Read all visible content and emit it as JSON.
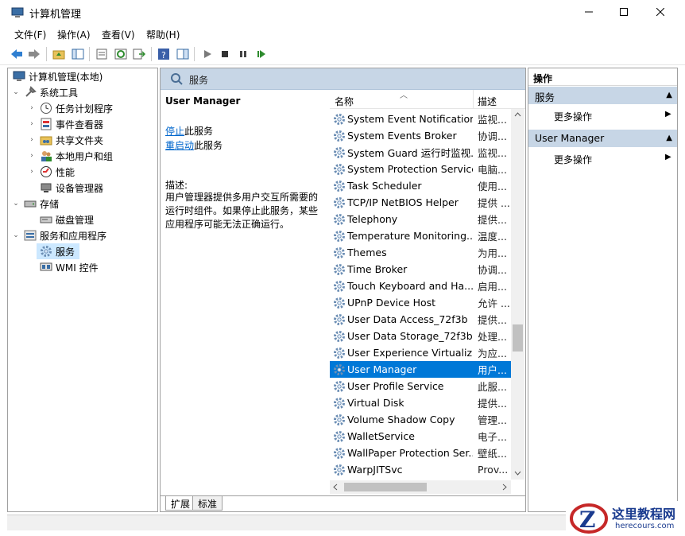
{
  "window": {
    "title": "计算机管理"
  },
  "menu": [
    "文件(F)",
    "操作(A)",
    "查看(V)",
    "帮助(H)"
  ],
  "tree": {
    "root": "计算机管理(本地)",
    "system_tools": "系统工具",
    "task_scheduler": "任务计划程序",
    "event_viewer": "事件查看器",
    "shared_folders": "共享文件夹",
    "local_users": "本地用户和组",
    "performance": "性能",
    "device_manager": "设备管理器",
    "storage": "存储",
    "disk_mgmt": "磁盘管理",
    "services_apps": "服务和应用程序",
    "services": "服务",
    "wmi": "WMI 控件"
  },
  "services_panel": {
    "header": "服务",
    "selected_name": "User Manager",
    "stop_link": "停止",
    "stop_suffix": "此服务",
    "restart_link": "重启动",
    "restart_suffix": "此服务",
    "desc_label": "描述:",
    "description": "用户管理器提供多用户交互所需要的运行时组件。如果停止此服务，某些应用程序可能无法正确运行。",
    "col_name": "名称",
    "col_desc": "描述",
    "rows": [
      {
        "name": "System Event Notification...",
        "desc": "监视..."
      },
      {
        "name": "System Events Broker",
        "desc": "协调..."
      },
      {
        "name": "System Guard 运行时监视...",
        "desc": "监视..."
      },
      {
        "name": "System Protection Service",
        "desc": "电脑..."
      },
      {
        "name": "Task Scheduler",
        "desc": "使用..."
      },
      {
        "name": "TCP/IP NetBIOS Helper",
        "desc": "提供 ..."
      },
      {
        "name": "Telephony",
        "desc": "提供..."
      },
      {
        "name": "Temperature Monitoring...",
        "desc": "温度..."
      },
      {
        "name": "Themes",
        "desc": "为用..."
      },
      {
        "name": "Time Broker",
        "desc": "协调..."
      },
      {
        "name": "Touch Keyboard and Ha...",
        "desc": "启用..."
      },
      {
        "name": "UPnP Device Host",
        "desc": "允许 ..."
      },
      {
        "name": "User Data Access_72f3b",
        "desc": "提供..."
      },
      {
        "name": "User Data Storage_72f3b",
        "desc": "处理..."
      },
      {
        "name": "User Experience Virtualiz...",
        "desc": "为应..."
      },
      {
        "name": "User Manager",
        "desc": "用户..."
      },
      {
        "name": "User Profile Service",
        "desc": "此服..."
      },
      {
        "name": "Virtual Disk",
        "desc": "提供..."
      },
      {
        "name": "Volume Shadow Copy",
        "desc": "管理..."
      },
      {
        "name": "WalletService",
        "desc": "电子..."
      },
      {
        "name": "WallPaper Protection Ser...",
        "desc": "壁纸..."
      },
      {
        "name": "WarpJITSvc",
        "desc": "Prov..."
      }
    ],
    "selected_row": 15,
    "tabs": [
      "扩展",
      "标准"
    ]
  },
  "actions": {
    "title": "操作",
    "section1": "服务",
    "section1_item": "更多操作",
    "section2": "User Manager",
    "section2_item": "更多操作"
  },
  "watermark": {
    "site": "这里教程网",
    "url": "herecours.com"
  },
  "colors": {
    "selection": "#0078d7",
    "header": "#c7d6e6",
    "tree_selection": "#cce8ff"
  }
}
